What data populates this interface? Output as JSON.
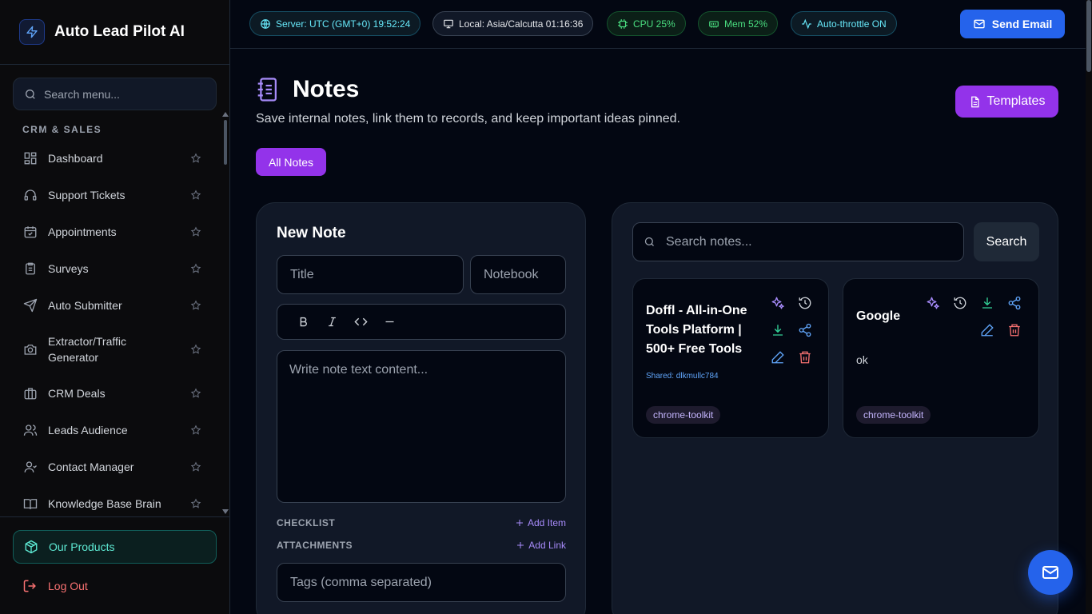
{
  "app": {
    "title": "Auto Lead Pilot AI"
  },
  "sidebar": {
    "search_placeholder": "Search menu...",
    "section": "CRM & SALES",
    "items": [
      {
        "label": "Dashboard",
        "icon": "dashboard-icon"
      },
      {
        "label": "Support Tickets",
        "icon": "headset-icon"
      },
      {
        "label": "Appointments",
        "icon": "calendar-check-icon"
      },
      {
        "label": "Surveys",
        "icon": "clipboard-icon"
      },
      {
        "label": "Auto Submitter",
        "icon": "send-icon"
      },
      {
        "label": "Extractor/Traffic Generator",
        "icon": "camera-icon"
      },
      {
        "label": "CRM Deals",
        "icon": "briefcase-icon"
      },
      {
        "label": "Leads Audience",
        "icon": "users-icon"
      },
      {
        "label": "Contact Manager",
        "icon": "user-icon"
      },
      {
        "label": "Knowledge Base Brain",
        "icon": "book-open-icon"
      }
    ],
    "products_label": "Our Products",
    "logout_label": "Log Out"
  },
  "topbar": {
    "server": "Server: UTC (GMT+0) 19:52:24",
    "local": "Local: Asia/Calcutta 01:16:36",
    "cpu": "CPU 25%",
    "mem": "Mem 52%",
    "throttle": "Auto-throttle ON",
    "send_email": "Send Email"
  },
  "page": {
    "title": "Notes",
    "subtitle": "Save internal notes, link them to records, and keep important ideas pinned.",
    "templates_label": "Templates",
    "tab_all": "All Notes"
  },
  "new_note": {
    "heading": "New Note",
    "title_placeholder": "Title",
    "notebook_placeholder": "Notebook",
    "content_placeholder": "Write note text content...",
    "checklist_label": "CHECKLIST",
    "add_item": "Add Item",
    "attachments_label": "ATTACHMENTS",
    "add_link": "Add Link",
    "tags_placeholder": "Tags (comma separated)"
  },
  "notes_list": {
    "search_placeholder": "Search notes...",
    "search_button": "Search",
    "cards": [
      {
        "title": "Doffl - All-in-One Tools Platform | 500+ Free Tools",
        "shared": "Shared: dlkmullc784",
        "body": "",
        "tag": "chrome-toolkit"
      },
      {
        "title": "Google",
        "shared": "",
        "body": "ok",
        "tag": "chrome-toolkit"
      }
    ]
  },
  "colors": {
    "accent_purple": "#9333ea",
    "accent_blue": "#2563eb",
    "teal": "#5eead4",
    "danger": "#f87171"
  }
}
